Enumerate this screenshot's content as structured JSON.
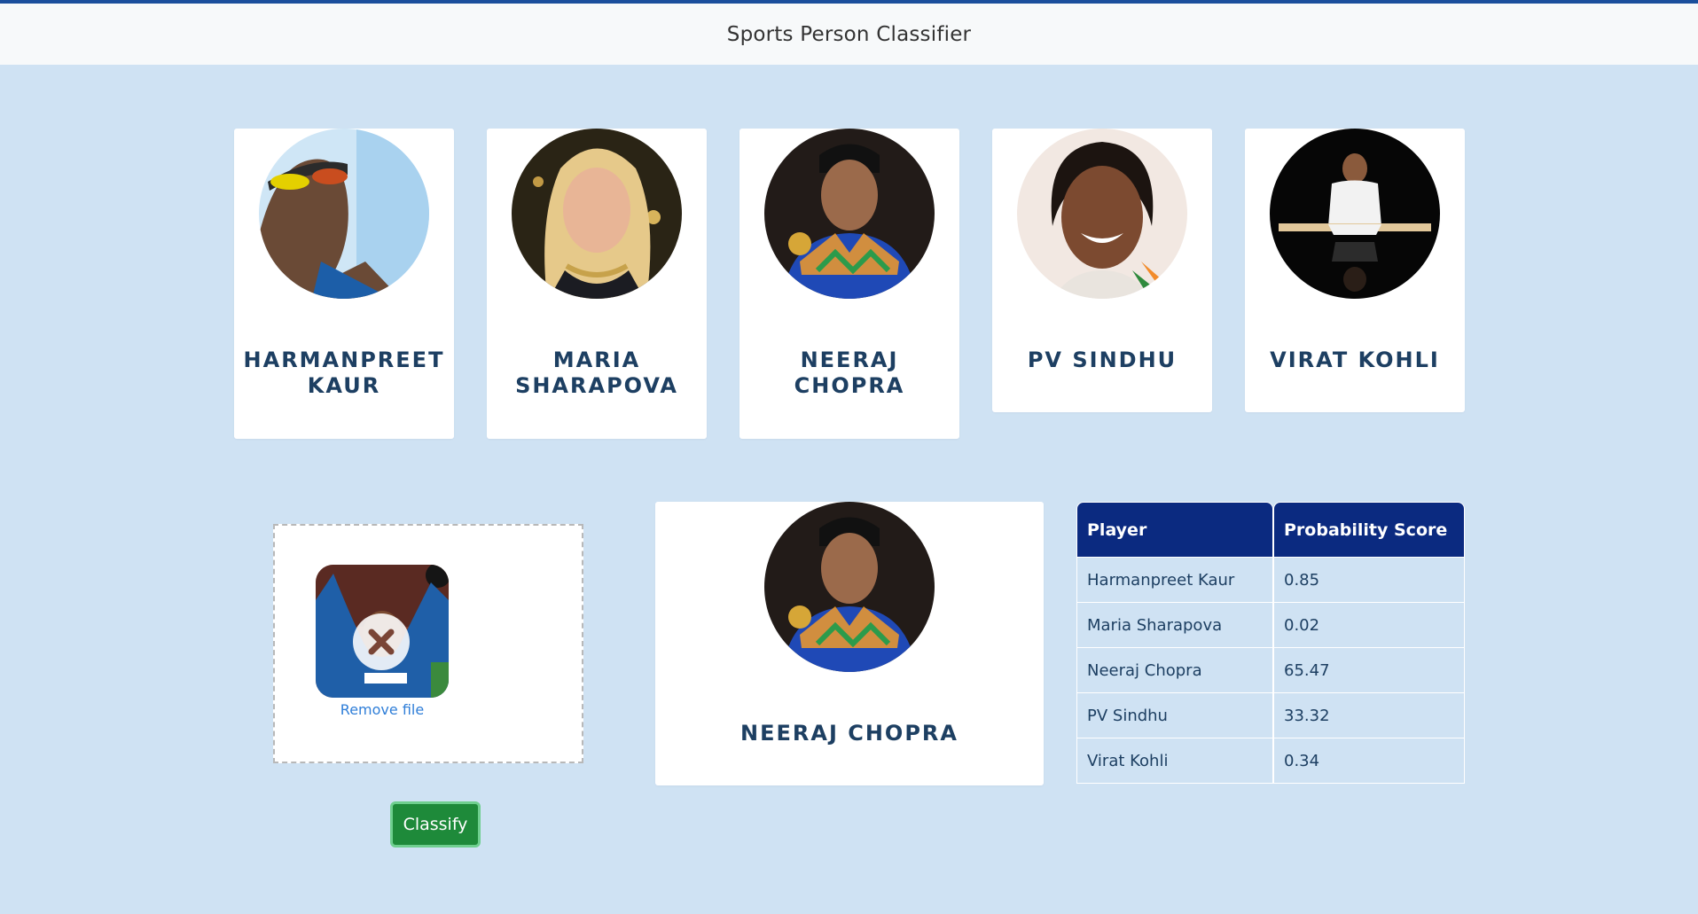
{
  "header": {
    "title": "Sports Person Classifier"
  },
  "players": [
    {
      "name": "Harmanpreet Kaur"
    },
    {
      "name": "Maria Sharapova"
    },
    {
      "name": "Neeraj Chopra"
    },
    {
      "name": "PV Sindhu"
    },
    {
      "name": "Virat Kohli"
    }
  ],
  "upload": {
    "remove_label": "Remove file"
  },
  "classify_button": {
    "label": "Classify"
  },
  "result": {
    "name": "Neeraj Chopra"
  },
  "table": {
    "headers": [
      "Player",
      "Probability Score"
    ],
    "rows": [
      {
        "player": "Harmanpreet Kaur",
        "score": "0.85"
      },
      {
        "player": "Maria Sharapova",
        "score": "0.02"
      },
      {
        "player": "Neeraj Chopra",
        "score": "65.47"
      },
      {
        "player": "PV Sindhu",
        "score": "33.32"
      },
      {
        "player": "Virat Kohli",
        "score": "0.34"
      }
    ]
  },
  "colors": {
    "background": "#cfe2f3",
    "header_accent": "#1b4f9c",
    "table_header": "#0b2a80",
    "name_text": "#1d3f62",
    "classify_button": "#1e8a3a"
  }
}
